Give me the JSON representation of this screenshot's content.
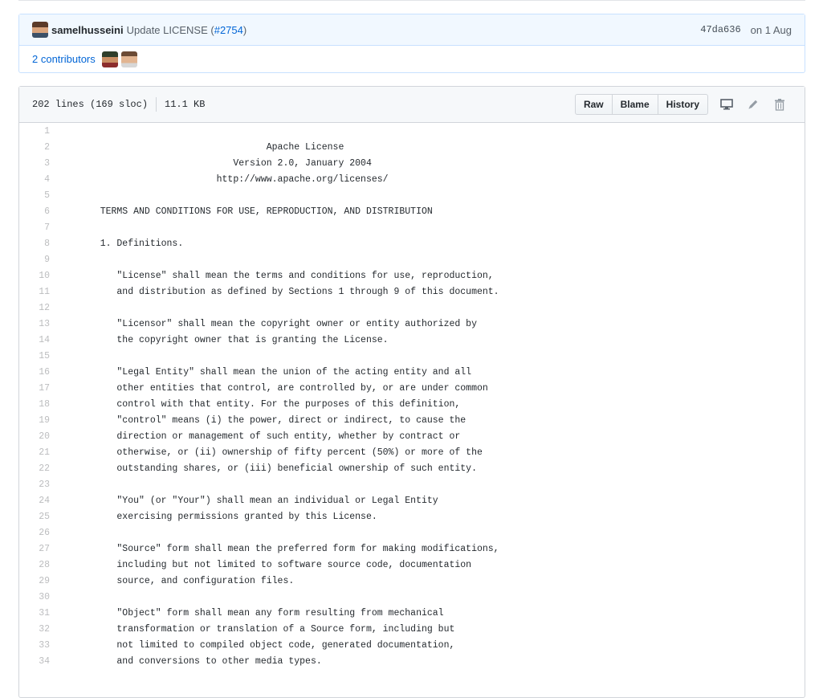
{
  "commit": {
    "author": "samelhusseini",
    "message": "Update LICENSE (",
    "pr": "#2754",
    "message_end": ")",
    "sha": "47da636",
    "date": "on 1 Aug"
  },
  "contributors": {
    "label": "2 contributors"
  },
  "file": {
    "lines_info": "202 lines (169 sloc)",
    "size": "11.1 KB",
    "buttons": {
      "raw": "Raw",
      "blame": "Blame",
      "history": "History"
    }
  },
  "icons": [
    "desktop-icon",
    "pencil-icon",
    "trash-icon"
  ],
  "lines": [
    {
      "n": "1",
      "t": ""
    },
    {
      "n": "2",
      "t": "                                 Apache License"
    },
    {
      "n": "3",
      "t": "                           Version 2.0, January 2004"
    },
    {
      "n": "4",
      "t": "                        http://www.apache.org/licenses/"
    },
    {
      "n": "5",
      "t": ""
    },
    {
      "n": "6",
      "t": "   TERMS AND CONDITIONS FOR USE, REPRODUCTION, AND DISTRIBUTION"
    },
    {
      "n": "7",
      "t": ""
    },
    {
      "n": "8",
      "t": "   1. Definitions."
    },
    {
      "n": "9",
      "t": ""
    },
    {
      "n": "10",
      "t": "      \"License\" shall mean the terms and conditions for use, reproduction,"
    },
    {
      "n": "11",
      "t": "      and distribution as defined by Sections 1 through 9 of this document."
    },
    {
      "n": "12",
      "t": ""
    },
    {
      "n": "13",
      "t": "      \"Licensor\" shall mean the copyright owner or entity authorized by"
    },
    {
      "n": "14",
      "t": "      the copyright owner that is granting the License."
    },
    {
      "n": "15",
      "t": ""
    },
    {
      "n": "16",
      "t": "      \"Legal Entity\" shall mean the union of the acting entity and all"
    },
    {
      "n": "17",
      "t": "      other entities that control, are controlled by, or are under common"
    },
    {
      "n": "18",
      "t": "      control with that entity. For the purposes of this definition,"
    },
    {
      "n": "19",
      "t": "      \"control\" means (i) the power, direct or indirect, to cause the"
    },
    {
      "n": "20",
      "t": "      direction or management of such entity, whether by contract or"
    },
    {
      "n": "21",
      "t": "      otherwise, or (ii) ownership of fifty percent (50%) or more of the"
    },
    {
      "n": "22",
      "t": "      outstanding shares, or (iii) beneficial ownership of such entity."
    },
    {
      "n": "23",
      "t": ""
    },
    {
      "n": "24",
      "t": "      \"You\" (or \"Your\") shall mean an individual or Legal Entity"
    },
    {
      "n": "25",
      "t": "      exercising permissions granted by this License."
    },
    {
      "n": "26",
      "t": ""
    },
    {
      "n": "27",
      "t": "      \"Source\" form shall mean the preferred form for making modifications,"
    },
    {
      "n": "28",
      "t": "      including but not limited to software source code, documentation"
    },
    {
      "n": "29",
      "t": "      source, and configuration files."
    },
    {
      "n": "30",
      "t": ""
    },
    {
      "n": "31",
      "t": "      \"Object\" form shall mean any form resulting from mechanical"
    },
    {
      "n": "32",
      "t": "      transformation or translation of a Source form, including but"
    },
    {
      "n": "33",
      "t": "      not limited to compiled object code, generated documentation,"
    },
    {
      "n": "34",
      "t": "      and conversions to other media types."
    }
  ]
}
